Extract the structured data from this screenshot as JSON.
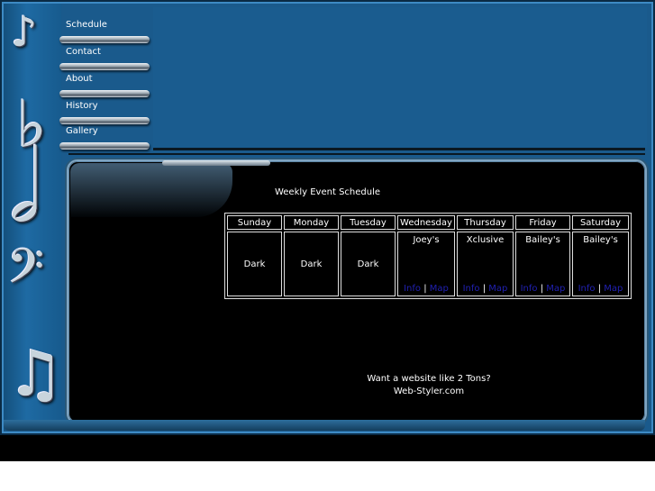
{
  "nav": {
    "items": [
      {
        "label": "Schedule"
      },
      {
        "label": "Contact"
      },
      {
        "label": "About"
      },
      {
        "label": "History"
      },
      {
        "label": "Gallery"
      }
    ]
  },
  "decor": {
    "notes": [
      "eighth-note-icon",
      "flat-icon",
      "bass-clef-icon",
      "beamed-notes-icon"
    ]
  },
  "schedule": {
    "title": "Weekly Event Schedule",
    "days": [
      "Sunday",
      "Monday",
      "Tuesday",
      "Wednesday",
      "Thursday",
      "Friday",
      "Saturday"
    ],
    "cells": [
      {
        "venue": "Dark"
      },
      {
        "venue": "Dark"
      },
      {
        "venue": "Dark"
      },
      {
        "venue": "Joey's",
        "info": "Info",
        "sep": "|",
        "map": "Map"
      },
      {
        "venue": "Xclusive",
        "info": "Info",
        "sep": "|",
        "map": "Map"
      },
      {
        "venue": "Bailey's",
        "info": "Info",
        "sep": "|",
        "map": "Map"
      },
      {
        "venue": "Bailey's",
        "info": "Info",
        "sep": "|",
        "map": "Map"
      }
    ]
  },
  "footer": {
    "line1": "Want a website like 2 Tons?",
    "line2": "Web-Styler.com"
  },
  "colors": {
    "frame": "#1a5a8c",
    "panel": "#000000",
    "link": "#2020b0"
  }
}
